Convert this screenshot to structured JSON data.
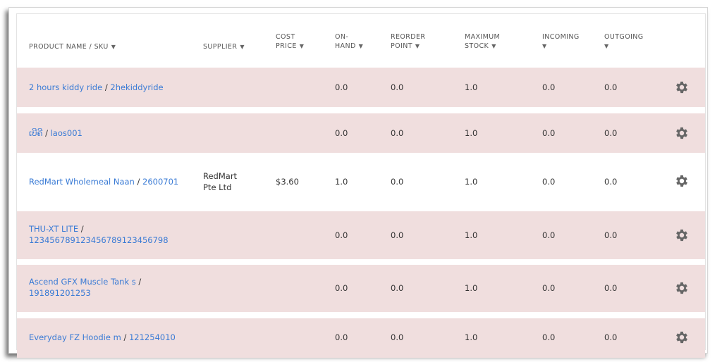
{
  "columns": {
    "product": [
      "PRODUCT NAME / SKU"
    ],
    "supplier": [
      "SUPPLIER"
    ],
    "cost": [
      "COST",
      "PRICE"
    ],
    "onhand": [
      "ON-",
      "HAND"
    ],
    "reorder": [
      "REORDER",
      "POINT"
    ],
    "max": [
      "MAXIMUM",
      "STOCK"
    ],
    "incoming": [
      "INCOMING",
      ""
    ],
    "outgoing": [
      "OUTGOING",
      ""
    ]
  },
  "rows": [
    {
      "name": "2 hours kiddy ride",
      "sku": "2hekiddyride",
      "supplier": "",
      "cost": "",
      "onhand": "0.0",
      "reorder": "0.0",
      "max": "1.0",
      "incoming": "0.0",
      "outgoing": "0.0"
    },
    {
      "name": "ເບີຄີ",
      "sku": "laos001",
      "supplier": "",
      "cost": "",
      "onhand": "0.0",
      "reorder": "0.0",
      "max": "1.0",
      "incoming": "0.0",
      "outgoing": "0.0"
    },
    {
      "name": "RedMart Wholemeal Naan",
      "sku": "2600701",
      "supplier": "RedMart Pte Ltd",
      "cost": "$3.60",
      "onhand": "1.0",
      "reorder": "0.0",
      "max": "1.0",
      "incoming": "0.0",
      "outgoing": "0.0"
    },
    {
      "name": "THU-XT LITE",
      "sku": "1234567891234567891234567​98",
      "supplier": "",
      "cost": "",
      "onhand": "0.0",
      "reorder": "0.0",
      "max": "1.0",
      "incoming": "0.0",
      "outgoing": "0.0"
    },
    {
      "name": "Ascend GFX Muscle Tank s",
      "sku": "191891201253",
      "supplier": "",
      "cost": "",
      "onhand": "0.0",
      "reorder": "0.0",
      "max": "1.0",
      "incoming": "0.0",
      "outgoing": "0.0"
    },
    {
      "name": "Everyday FZ Hoodie m",
      "sku": "121254010",
      "supplier": "",
      "cost": "",
      "onhand": "0.0",
      "reorder": "0.0",
      "max": "1.0",
      "incoming": "0.0",
      "outgoing": "0.0"
    }
  ],
  "row_action_icon": "gear-icon",
  "colors": {
    "row_highlight": "#f0dede",
    "link": "#3a7bd5"
  }
}
